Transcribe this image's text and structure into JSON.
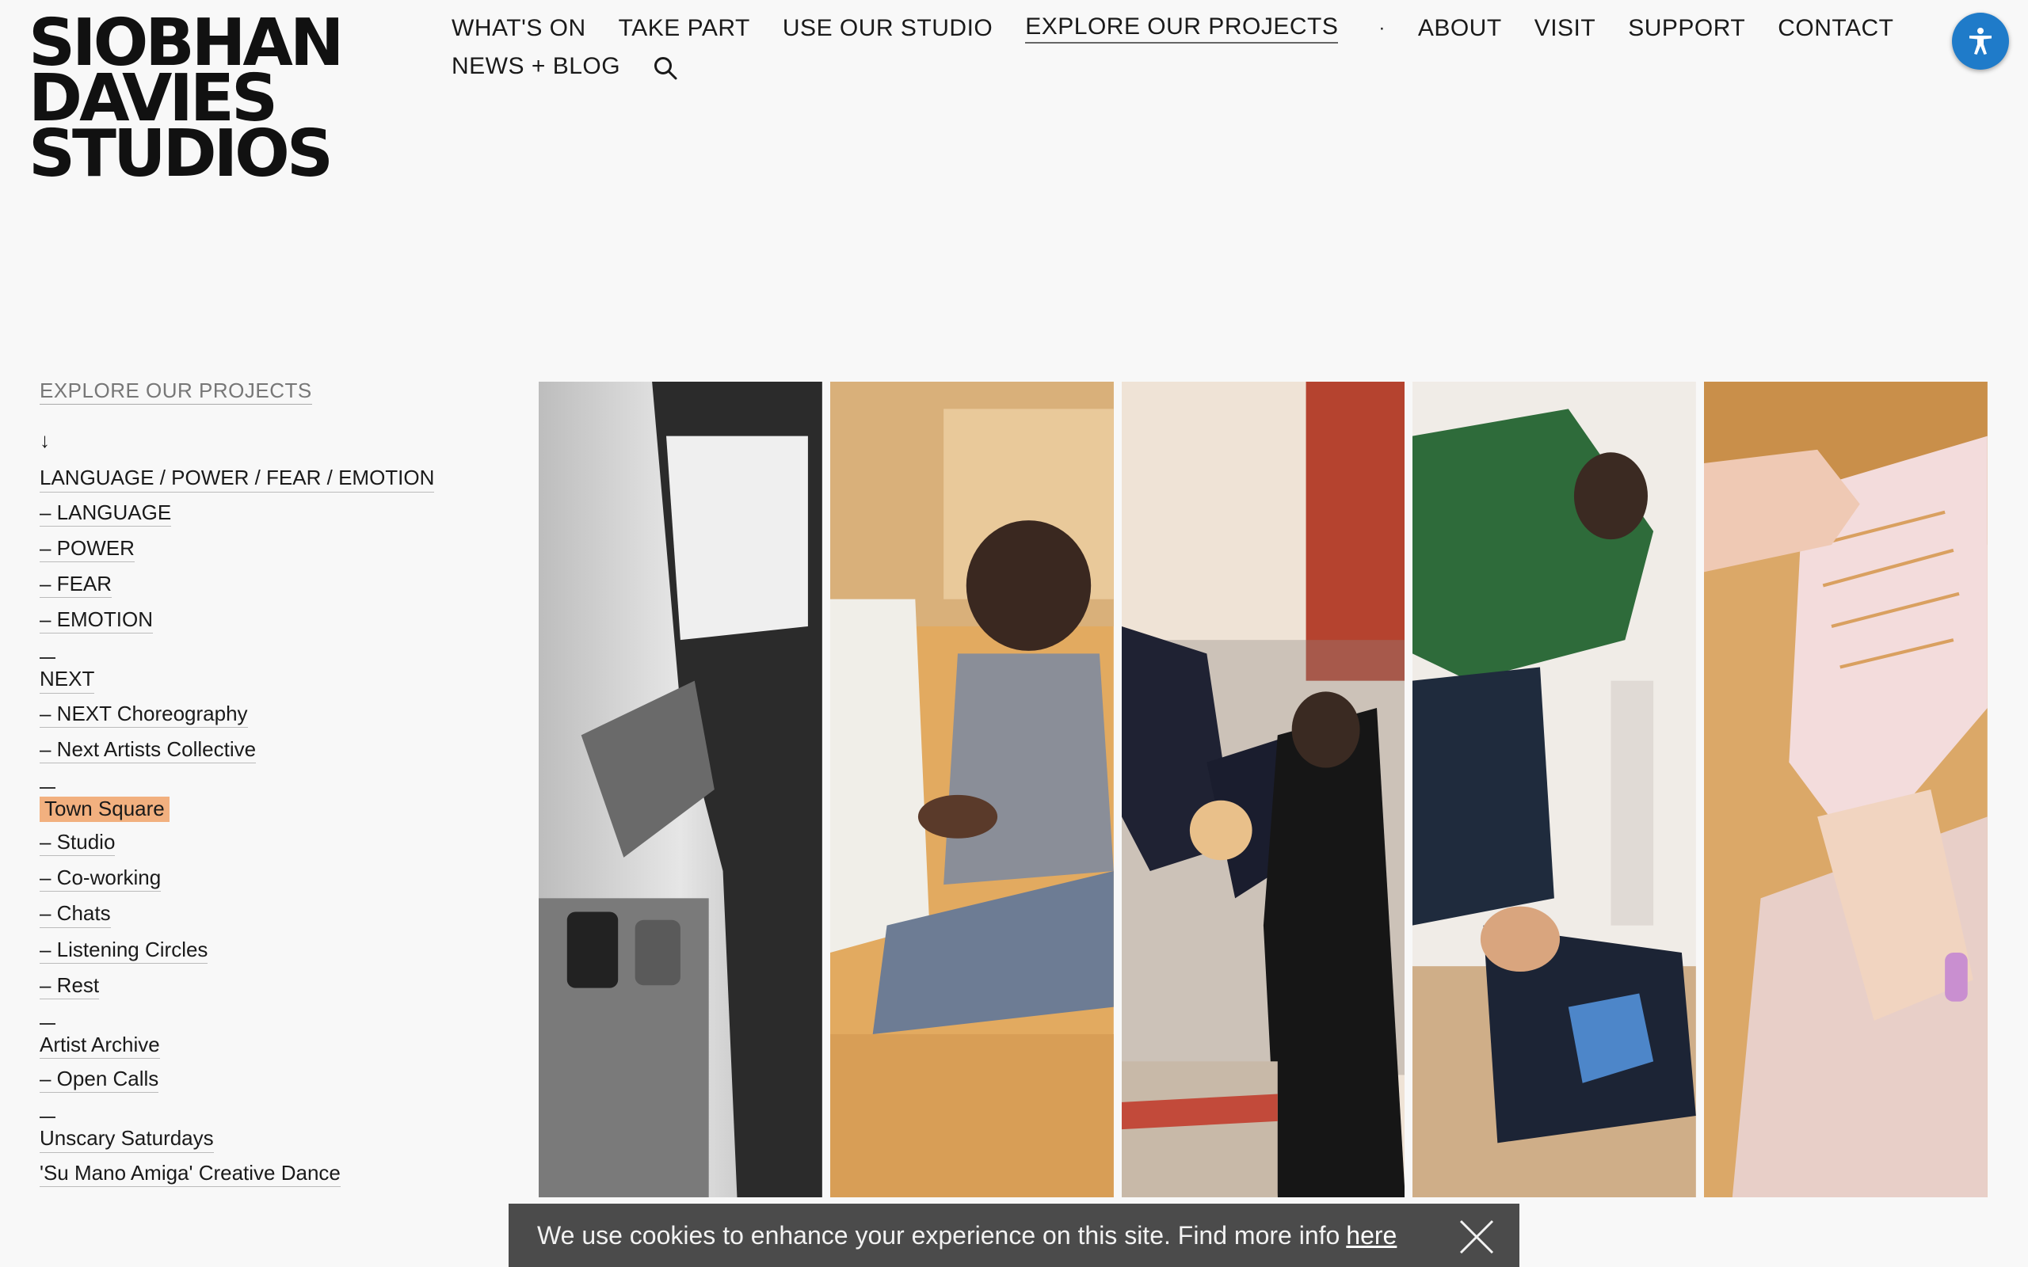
{
  "logo": {
    "line1": "SIOBHAN",
    "line2": "DAVIES",
    "line3": "STUDIOS"
  },
  "nav": {
    "row1": [
      "WHAT'S ON",
      "TAKE PART",
      "USE OUR STUDIO",
      "EXPLORE OUR PROJECTS"
    ],
    "separator": "·",
    "row1b": [
      "ABOUT",
      "VISIT",
      "SUPPORT",
      "CONTACT"
    ],
    "row2": [
      "NEWS + BLOG"
    ],
    "active": "EXPLORE OUR PROJECTS",
    "search_icon": "search-icon"
  },
  "accessibility": {
    "icon": "accessibility-icon",
    "color": "#1f7bc9"
  },
  "sidebar": {
    "title": "EXPLORE OUR PROJECTS",
    "arrow": "↓",
    "groups": [
      {
        "label": "LANGUAGE / POWER / FEAR / EMOTION",
        "items": [
          "– LANGUAGE",
          "– POWER",
          "– FEAR",
          "– EMOTION"
        ]
      },
      {
        "label": "NEXT",
        "items": [
          "– NEXT Choreography",
          "– Next Artists Collective"
        ]
      },
      {
        "label": "Town Square",
        "highlighted": true,
        "highlight_color": "#f2b07f",
        "items": [
          "– Studio",
          "– Co-working",
          "– Chats",
          "– Listening Circles",
          "– Rest"
        ]
      },
      {
        "label": "Artist Archive",
        "items": [
          "– Open Calls"
        ]
      },
      {
        "label": "Unscary Saturdays",
        "items": [
          "'Su Mano Amiga' Creative Dance"
        ]
      }
    ]
  },
  "gallery": {
    "panels": [
      {
        "name": "photo-hands-mugs",
        "palette": [
          "#d8d8d8",
          "#8a8a8a",
          "#2e2e2e"
        ]
      },
      {
        "name": "photo-seated-conversation",
        "palette": [
          "#e8b36a",
          "#6d5a52",
          "#3a2a24"
        ]
      },
      {
        "name": "photo-dancers-lift",
        "palette": [
          "#f0e6dc",
          "#b04030",
          "#1c1c28"
        ]
      },
      {
        "name": "photo-dancer-floor",
        "palette": [
          "#f1eeea",
          "#2f6a3a",
          "#1d2a3a"
        ]
      },
      {
        "name": "photo-hand-paper",
        "palette": [
          "#d9a464",
          "#f3d6d6",
          "#e8c7b0"
        ]
      }
    ]
  },
  "cookie": {
    "text": "We use cookies to enhance your experience on this site. Find more info",
    "link": "here",
    "close_icon": "close-icon"
  }
}
